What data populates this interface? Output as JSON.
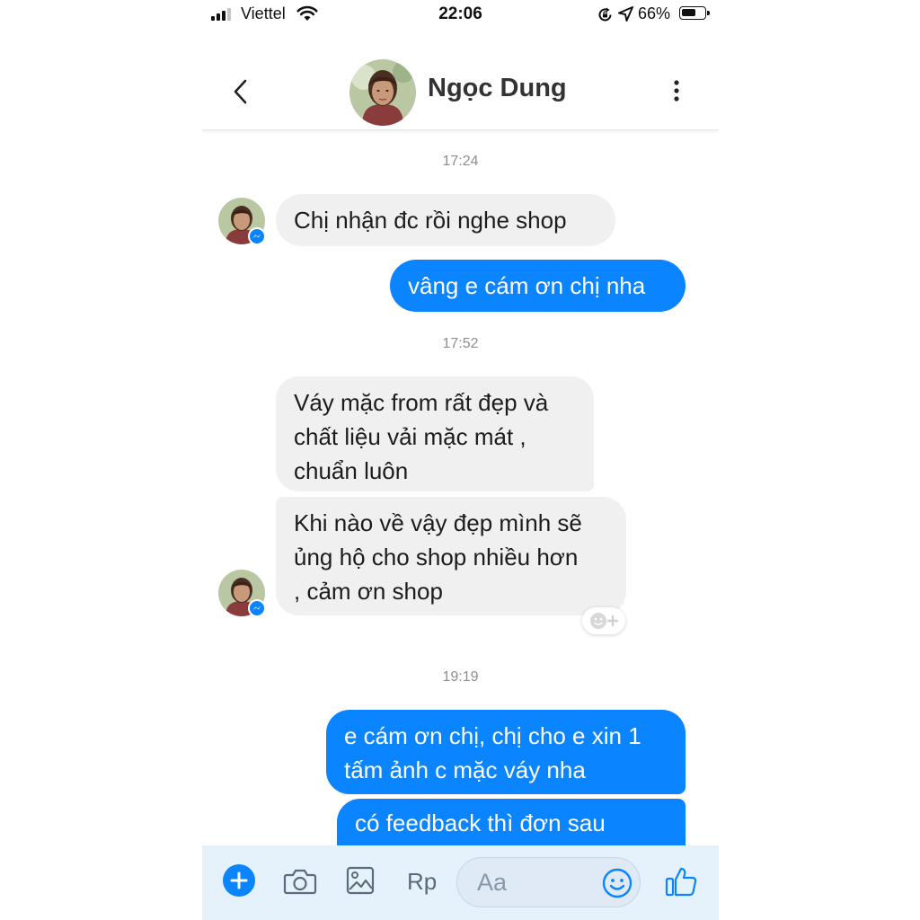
{
  "status_bar": {
    "carrier": "Viettel",
    "time": "22:06",
    "battery": "66%",
    "battery_level": 0.66
  },
  "header": {
    "contact_name": "Ngọc Dung"
  },
  "thread": {
    "timestamps": [
      "17:24",
      "17:52",
      "19:19"
    ],
    "messages": [
      {
        "from": "contact",
        "text": "Chị nhận đc rồi nghe shop"
      },
      {
        "from": "me",
        "text": "vâng e cám ơn chị nha"
      },
      {
        "from": "contact",
        "text": "Váy mặc from rất đẹp và\nchất liệu vải mặc mát ,\nchuẩn luôn"
      },
      {
        "from": "contact",
        "text": "Khi nào về vậy đẹp mình sẽ\nủng hộ cho shop nhiều hơn\n, cảm ơn shop"
      },
      {
        "from": "me",
        "text": "e cám ơn chị, chị cho e xin 1\ntấm ảnh c mặc váy nha"
      },
      {
        "from": "me",
        "text": "có feedback thì đơn sau"
      }
    ]
  },
  "composer": {
    "rp_label": "Rp",
    "placeholder": "Aa"
  },
  "colors": {
    "accent": "#0a84ff",
    "incoming_bubble": "#f0f0f0",
    "composer_bg": "#e5f2fc"
  }
}
